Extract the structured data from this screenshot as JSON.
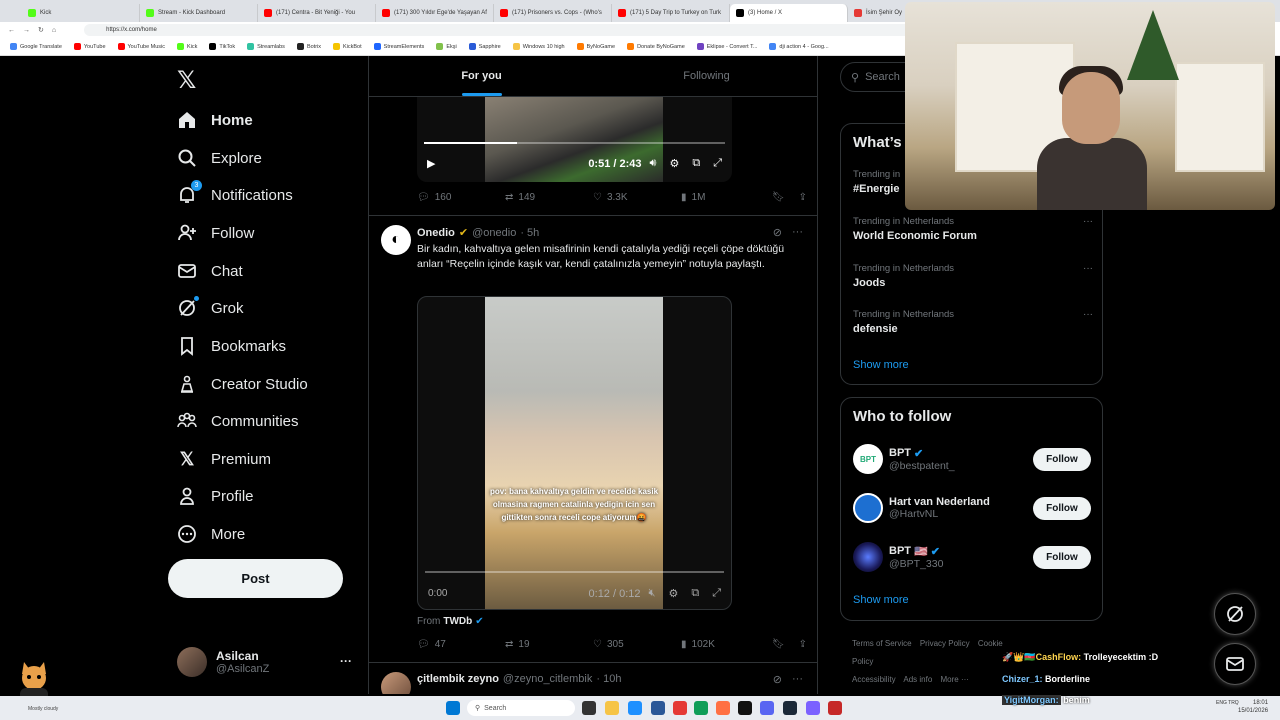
{
  "browser": {
    "tabs": [
      {
        "title": "Kick",
        "color": "#53fc18"
      },
      {
        "title": "Stream - Kick Dashboard",
        "color": "#53fc18"
      },
      {
        "title": "(171) Centra - Bit Yeniği - You",
        "color": "#ff0000"
      },
      {
        "title": "(171) 300 Yıldır Ege'de Yaşayan Af",
        "color": "#ff0000"
      },
      {
        "title": "(171) Prisoners vs. Cops - (Who's",
        "color": "#ff0000"
      },
      {
        "title": "(171) 5 Day Trip to Turkey on Turk",
        "color": "#ff0000"
      },
      {
        "title": "(3) Home / X",
        "color": "#000000"
      },
      {
        "title": "İsim Şehir Oy",
        "color": "#e53935"
      }
    ],
    "url": "https://x.com/home",
    "bookmarks": [
      {
        "label": "Google Translate",
        "color": "#4285f4"
      },
      {
        "label": "YouTube",
        "color": "#ff0000"
      },
      {
        "label": "YouTube Music",
        "color": "#ff0000"
      },
      {
        "label": "Kick",
        "color": "#53fc18"
      },
      {
        "label": "TikTok",
        "color": "#000000"
      },
      {
        "label": "Streamlabs",
        "color": "#31c3a2"
      },
      {
        "label": "Botrix",
        "color": "#222222"
      },
      {
        "label": "KickBot",
        "color": "#f5c400"
      },
      {
        "label": "StreamElements",
        "color": "#1e66ff"
      },
      {
        "label": "Ekşi",
        "color": "#81c14b"
      },
      {
        "label": "Sapphire",
        "color": "#2a5bd7"
      },
      {
        "label": "Windows 10 high",
        "color": "#f6c445"
      },
      {
        "label": "ByNoGame",
        "color": "#ff7a00"
      },
      {
        "label": "Donate ByNoGame",
        "color": "#ff7a00"
      },
      {
        "label": "Eklipse - Convert T...",
        "color": "#6f42c1"
      },
      {
        "label": "dji action 4 - Goog...",
        "color": "#4285f4"
      }
    ]
  },
  "nav": {
    "items": [
      {
        "label": "Home"
      },
      {
        "label": "Explore"
      },
      {
        "label": "Notifications",
        "badge": "3"
      },
      {
        "label": "Follow"
      },
      {
        "label": "Chat"
      },
      {
        "label": "Grok"
      },
      {
        "label": "Bookmarks"
      },
      {
        "label": "Creator Studio"
      },
      {
        "label": "Communities"
      },
      {
        "label": "Premium"
      },
      {
        "label": "Profile"
      },
      {
        "label": "More"
      }
    ],
    "post_label": "Post",
    "account": {
      "name": "Asilcan",
      "handle": "@AsilcanZ"
    }
  },
  "feed": {
    "tabs": [
      "For you",
      "Following"
    ],
    "tweet1": {
      "video_time": "0:51 / 2:43",
      "progress": 0.31,
      "replies": "160",
      "reposts": "149",
      "likes": "3.3K",
      "views": "1M"
    },
    "tweet2": {
      "name": "Onedio",
      "handle": "@onedio",
      "time": "· 5h",
      "text": "Bir kadın, kahvaltıya gelen misafirinin kendi çatalıyla yediği reçeli çöpe döktüğü anları “Reçelin içinde kaşık var, kendi çatalınızla yemeyin” notuyla paylaştı.",
      "overlay": "pov: bana kahvaltıya geldin ve recelde kasik olmasina ragmen catalinla yedigin icin sen gittikten sonra receli cope atiyorum🤬",
      "video_start": "0:00",
      "video_time": "0:12 / 0:12",
      "from_label": "From",
      "from_name": "TWDb",
      "replies": "47",
      "reposts": "19",
      "likes": "305",
      "views": "102K"
    },
    "tweet3": {
      "name": "çitlembik zeyno",
      "handle": "@zeyno_citlembik",
      "time": "· 10h"
    }
  },
  "right": {
    "search_placeholder": "Search",
    "trends_title": "What’s",
    "trends": [
      {
        "context": "Trending in",
        "name": "#Energie"
      },
      {
        "context": "Trending in Netherlands",
        "name": "World Economic Forum"
      },
      {
        "context": "Trending in Netherlands",
        "name": "Joods"
      },
      {
        "context": "Trending in Netherlands",
        "name": "defensie"
      }
    ],
    "show_more": "Show more",
    "who_title": "Who to follow",
    "who": [
      {
        "name": "BPT",
        "handle": "@bestpatent_",
        "flag": "",
        "color": "#ffffff"
      },
      {
        "name": "Hart van Nederland",
        "handle": "@HartvNL",
        "flag": "",
        "color": "#1d6fd1"
      },
      {
        "name": "BPT",
        "handle": "@BPT_330",
        "flag": "🇺🇸",
        "color": "#1a1a5a"
      }
    ],
    "follow_label": "Follow",
    "footer": [
      "Terms of Service",
      "Privacy Policy",
      "Cookie Policy",
      "Accessibility",
      "Ads info",
      "More ···"
    ]
  },
  "stream_chat": [
    {
      "user": "🚀👑🇦🇿CashFlow:",
      "msg": "Trolleyecektim :D"
    },
    {
      "user": "Chizer_1:",
      "msg": "Borderline"
    },
    {
      "user": "YigitMorgan:",
      "msg": "benim"
    }
  ],
  "taskbar": {
    "search": "Search",
    "left_text": "Mostly cloudy",
    "lang": "ENG TRQ",
    "time": "18:01",
    "date": "15/01/2026"
  }
}
